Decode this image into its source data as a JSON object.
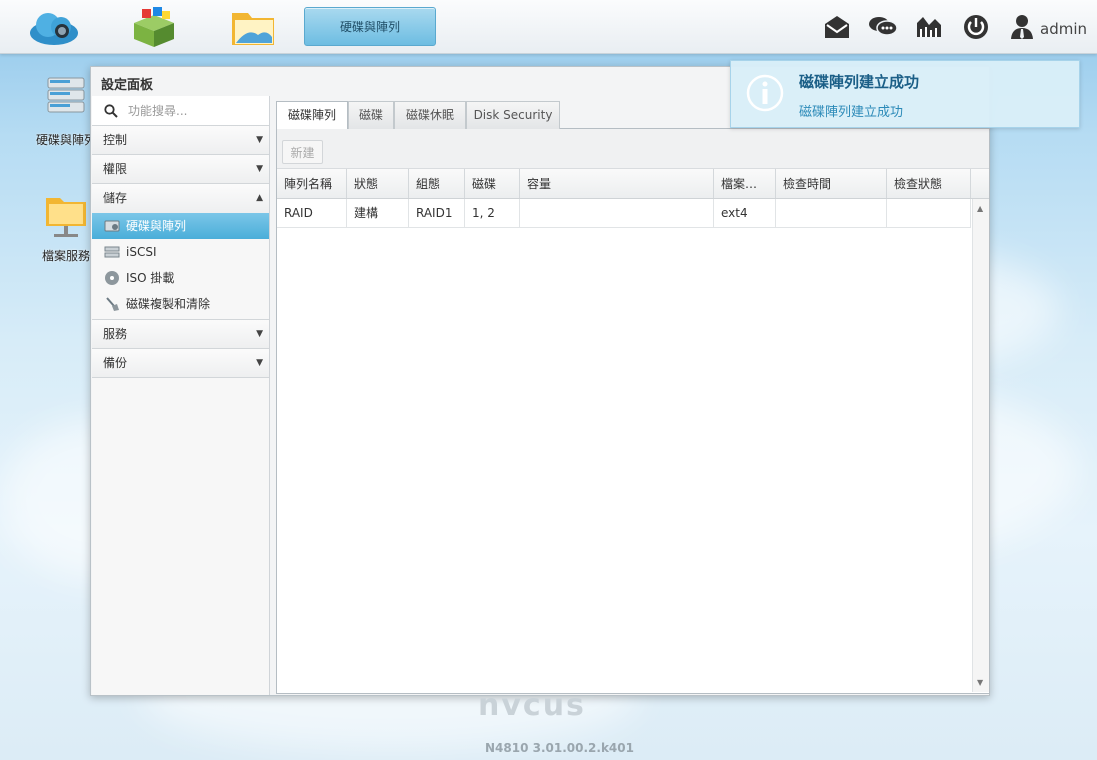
{
  "taskbar": {
    "active_task": "硬碟與陣列",
    "user": "admin"
  },
  "desktop": {
    "icons": [
      {
        "label": "硬碟與陣列"
      },
      {
        "label": "檔案服務"
      }
    ]
  },
  "window": {
    "title": "設定面板"
  },
  "sidebar": {
    "search_placeholder": "功能搜尋...",
    "categories": [
      {
        "label": "控制"
      },
      {
        "label": "權限"
      },
      {
        "label": "儲存"
      },
      {
        "label": "服務"
      },
      {
        "label": "備份"
      }
    ],
    "storage_items": [
      {
        "label": "硬碟與陣列"
      },
      {
        "label": "iSCSI"
      },
      {
        "label": "ISO 掛載"
      },
      {
        "label": "磁碟複製和清除"
      }
    ]
  },
  "tabs": [
    {
      "label": "磁碟陣列"
    },
    {
      "label": "磁碟"
    },
    {
      "label": "磁碟休眠"
    },
    {
      "label": "Disk Security"
    }
  ],
  "toolbar": {
    "new_label": "新建"
  },
  "table": {
    "columns": [
      "陣列名稱",
      "狀態",
      "組態",
      "磁碟",
      "容量",
      "檔案…",
      "檢查時間",
      "檢查狀態"
    ],
    "rows": [
      [
        "RAID",
        "建構",
        "RAID1",
        "1, 2",
        "",
        "ext4",
        "",
        ""
      ]
    ]
  },
  "notification": {
    "title": "磁碟陣列建立成功",
    "message": "磁碟陣列建立成功"
  },
  "footer": {
    "logo": "nvcus",
    "version": "N4810   3.01.00.2.k401"
  },
  "colors": {
    "accent": "#4aaed9",
    "notification_title": "#1b5f87"
  }
}
